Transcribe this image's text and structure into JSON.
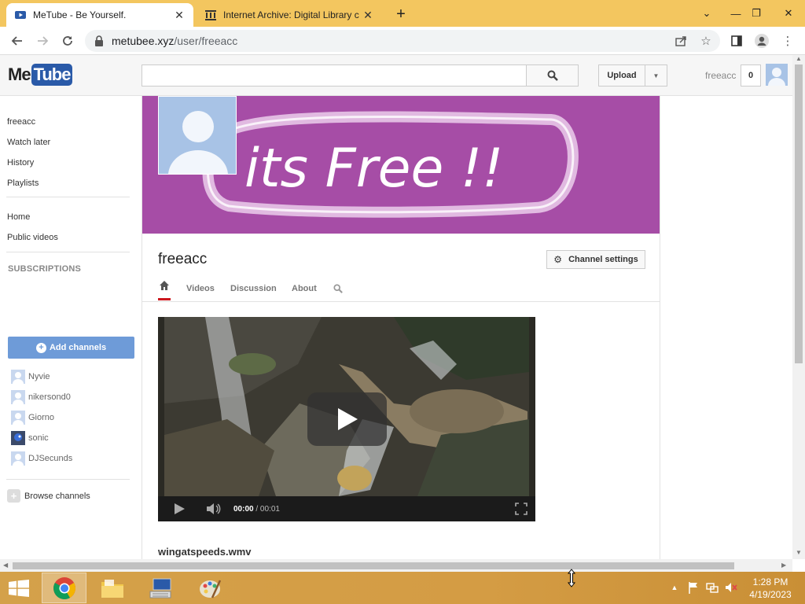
{
  "browser": {
    "tabs": [
      {
        "title": "MeTube - Be Yourself.",
        "active": true,
        "icon": "metube-favicon"
      },
      {
        "title": "Internet Archive: Digital Library c",
        "active": false,
        "icon": "archive-favicon"
      }
    ],
    "url_host": "metubee.xyz",
    "url_path": "/user/freeacc"
  },
  "site": {
    "logo_me": "Me",
    "logo_tube": "Tube",
    "search_placeholder": "",
    "upload_label": "Upload",
    "header_user": "freeacc",
    "notification_count": "0"
  },
  "guide": {
    "items": [
      "freeacc",
      "Watch later",
      "History",
      "Playlists"
    ],
    "items2": [
      "Home",
      "Public videos"
    ],
    "subscriptions_heading": "SUBSCRIPTIONS",
    "add_channels_label": "Add channels",
    "subscriptions": [
      "Nyvie",
      "nikersond0",
      "Giorno",
      "sonic",
      "DJSecunds"
    ],
    "browse_label": "Browse channels"
  },
  "channel": {
    "banner_text": "its Free !!",
    "title": "freeacc",
    "settings_label": "Channel settings",
    "tabs": [
      "Videos",
      "Discussion",
      "About"
    ],
    "player": {
      "current_time": "00:00",
      "separator": " / ",
      "duration": "00:01"
    },
    "video_title": "wingatspeeds.wmv"
  },
  "taskbar": {
    "time": "1:28 PM",
    "date": "4/19/2023"
  },
  "colors": {
    "banner": "#a64da6",
    "tabbar": "#f3c65f",
    "accent": "#6e9bd8",
    "taskbar": "#d4a14a"
  }
}
